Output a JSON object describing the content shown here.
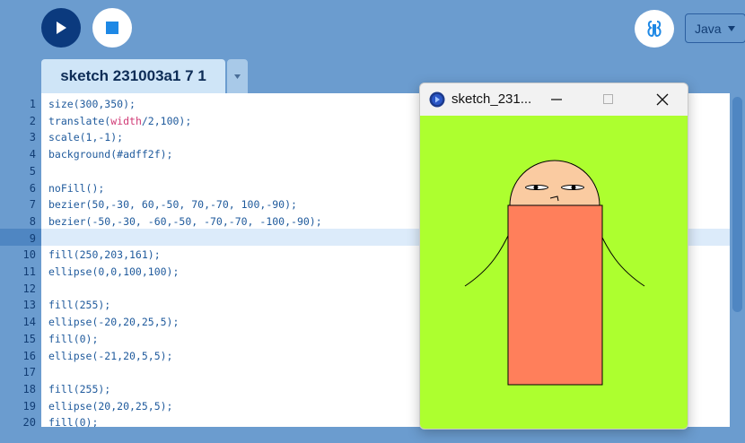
{
  "toolbar": {
    "run_icon": "play-icon",
    "stop_icon": "stop-icon",
    "debug_icon": "debugger-icon",
    "mode_label": "Java",
    "mode_icon": "caret-down-icon"
  },
  "tabs": [
    {
      "label": "sketch 231003a1 7 1"
    }
  ],
  "editor": {
    "highlighted_line": 9,
    "lines": [
      {
        "num": "1",
        "pre": "size(300,350);",
        "pink": "",
        "post": ""
      },
      {
        "num": "2",
        "pre": "translate(",
        "pink": "width",
        "post": "/2,100);"
      },
      {
        "num": "3",
        "pre": "scale(1,-1);",
        "pink": "",
        "post": ""
      },
      {
        "num": "4",
        "pre": "background(#adff2f);",
        "pink": "",
        "post": ""
      },
      {
        "num": "5",
        "pre": "",
        "pink": "",
        "post": ""
      },
      {
        "num": "6",
        "pre": "noFill();",
        "pink": "",
        "post": ""
      },
      {
        "num": "7",
        "pre": "bezier(50,-30, 60,-50, 70,-70, 100,-90);",
        "pink": "",
        "post": ""
      },
      {
        "num": "8",
        "pre": "bezier(-50,-30, -60,-50, -70,-70, -100,-90);",
        "pink": "",
        "post": ""
      },
      {
        "num": "9",
        "pre": "",
        "pink": "",
        "post": ""
      },
      {
        "num": "10",
        "pre": "fill(250,203,161);",
        "pink": "",
        "post": ""
      },
      {
        "num": "11",
        "pre": "ellipse(0,0,100,100);",
        "pink": "",
        "post": ""
      },
      {
        "num": "12",
        "pre": "",
        "pink": "",
        "post": ""
      },
      {
        "num": "13",
        "pre": "fill(255);",
        "pink": "",
        "post": ""
      },
      {
        "num": "14",
        "pre": "ellipse(-20,20,25,5);",
        "pink": "",
        "post": ""
      },
      {
        "num": "15",
        "pre": "fill(0);",
        "pink": "",
        "post": ""
      },
      {
        "num": "16",
        "pre": "ellipse(-21,20,5,5);",
        "pink": "",
        "post": ""
      },
      {
        "num": "17",
        "pre": "",
        "pink": "",
        "post": ""
      },
      {
        "num": "18",
        "pre": "fill(255);",
        "pink": "",
        "post": ""
      },
      {
        "num": "19",
        "pre": "ellipse(20,20,25,5);",
        "pink": "",
        "post": ""
      },
      {
        "num": "20",
        "pre": "fill(0);",
        "pink": "",
        "post": ""
      }
    ]
  },
  "sketch_window": {
    "title": "sketch_231...",
    "app_icon": "processing-icon",
    "minimize_icon": "minimize-icon",
    "maximize_icon": "maximize-icon",
    "close_icon": "close-icon",
    "canvas_background": "#adff2f",
    "head_color": "#facba1",
    "body_color": "#ff7f5b"
  },
  "colors": {
    "app_background": "#6b9ccf",
    "run_button": "#0b3a7e",
    "accent_blue": "#1e88e5"
  }
}
